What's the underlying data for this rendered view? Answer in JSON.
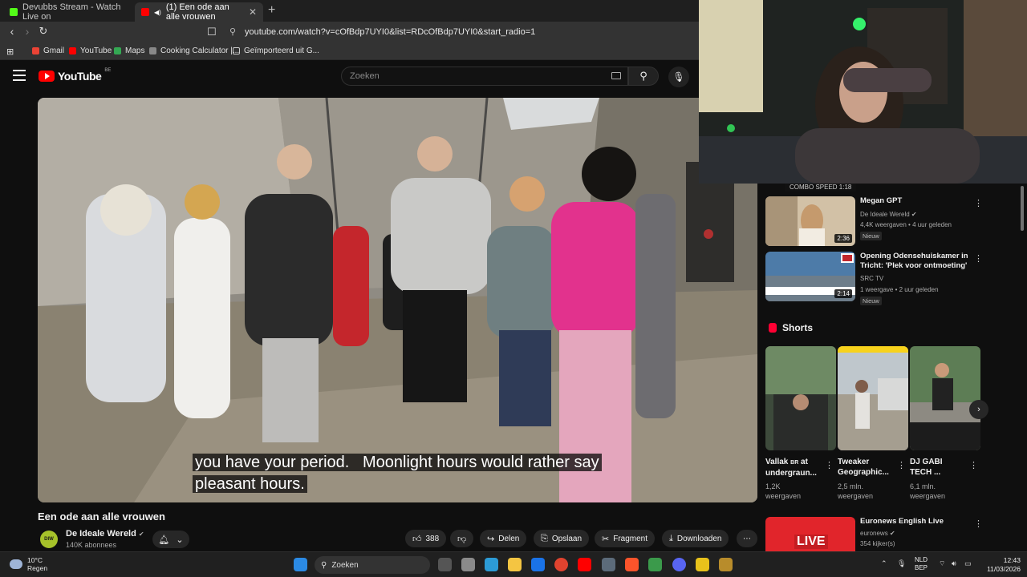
{
  "browser": {
    "tabs": [
      {
        "title": "Devubbs Stream - Watch Live on",
        "color": "#53fc18",
        "active": false
      },
      {
        "title": "(1) Een ode aan alle vrouwen",
        "color": "#ff0000",
        "active": true
      }
    ],
    "url": "youtube.com/watch?v=cOfBdp7UYI0&list=RDcOfBdp7UYI0&start_radio=1",
    "bookmarks": [
      {
        "label": "Gmail",
        "color": "#ea4335"
      },
      {
        "label": "YouTube",
        "color": "#ff0000"
      },
      {
        "label": "Maps",
        "color": "#34a853"
      },
      {
        "label": "Cooking Calculator |...",
        "color": "#888888"
      },
      {
        "label": "Geïmporteerd uit G...",
        "color": "#cccccc"
      }
    ]
  },
  "header": {
    "logo": "YouTube",
    "country": "BE",
    "search_placeholder": "Zoeken"
  },
  "video": {
    "caption_line1": "you have your period.   Moonlight hours would rather say",
    "caption_line2": "pleasant hours.",
    "title": "Een ode aan alle vrouwen",
    "channel": "De Ideale Wereld",
    "channel_avatar": "DIW",
    "subscribers": "140K abonnees",
    "likes": "388",
    "actions": {
      "share": "Delen",
      "save": "Opslaan",
      "clip": "Fragment",
      "download": "Downloaden"
    }
  },
  "webcam_overlay": {
    "label": "COMBO SPEED 1:18"
  },
  "sidebar": {
    "recommendations": [
      {
        "title": "Megan GPT",
        "channel": "De Ideale Wereld",
        "meta": "4,4K weergaven • 4 uur geleden",
        "badge": "Nieuw",
        "duration": "2:36",
        "verified": true
      },
      {
        "title": "Opening Odensehuiskamer in Tricht: 'Plek voor ontmoeting'",
        "channel": "SRC TV",
        "meta": "1 weergave • 2 uur geleden",
        "badge": "Nieuw",
        "duration": "2:14",
        "verified": false
      }
    ],
    "shorts_heading": "Shorts",
    "shorts": [
      {
        "title": "Vallak",
        "title_rest": "at undergraun...",
        "views": "1,2K",
        "views_label": "weergaven"
      },
      {
        "title": "Tweaker Geographic...",
        "views": "2,5 mln.",
        "views_label": "weergaven"
      },
      {
        "title": "DJ GABI TECH ...",
        "views": "6,1 mln.",
        "views_label": "weergaven"
      }
    ],
    "live": {
      "title": "Euronews English Live",
      "channel": "euronews",
      "meta": "354 kijker(s)",
      "thumb_label": "LIVE"
    }
  },
  "taskbar": {
    "temperature": "10°C",
    "weather": "Regen",
    "search": "Zoeken",
    "lang1": "NLD",
    "lang2": "BEP",
    "time": "12:43",
    "date": "11/03/2026"
  }
}
